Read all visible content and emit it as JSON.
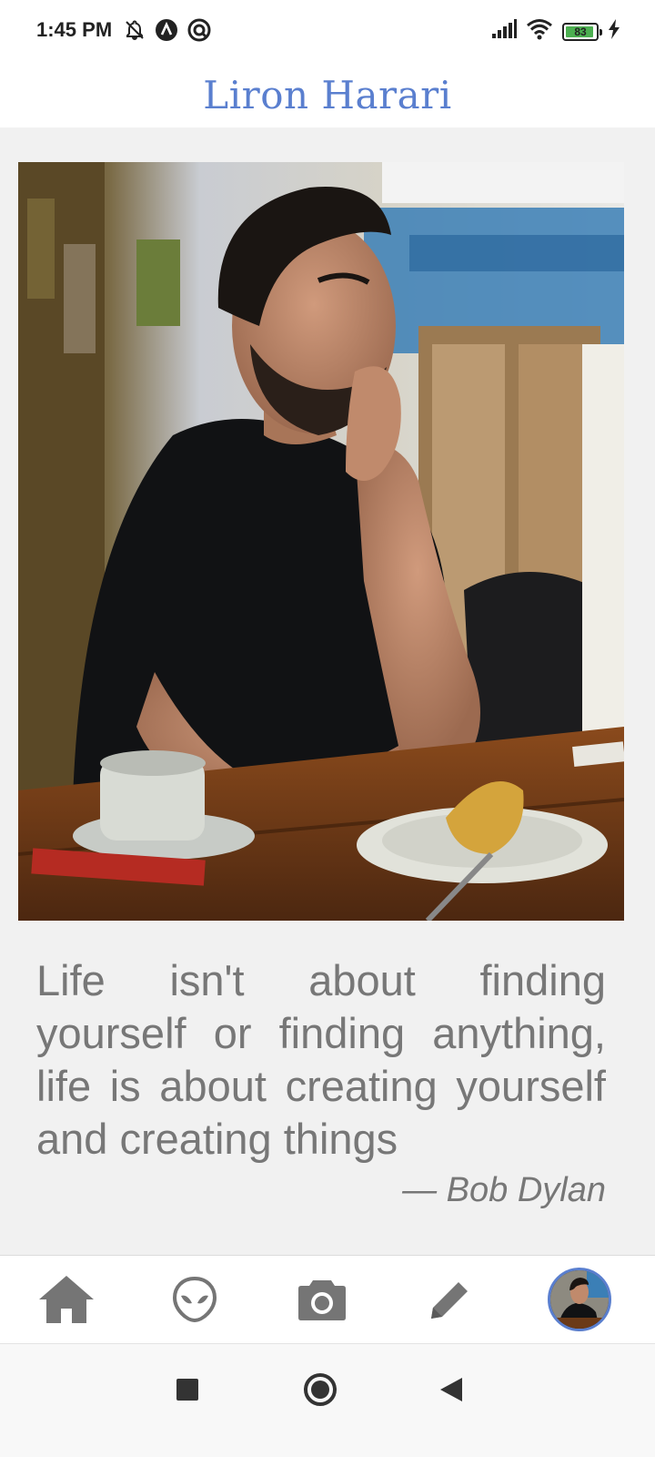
{
  "status_bar": {
    "time": "1:45 PM",
    "battery_level": "83",
    "left_icons": [
      "notifications-off-icon",
      "app-a-icon",
      "app-circle-icon"
    ],
    "right_icons": [
      "signal-icon",
      "wifi-icon",
      "battery-icon",
      "charging-icon"
    ]
  },
  "header": {
    "title": "Liron Harari"
  },
  "main": {
    "photo_description_icon": "profile-photo",
    "quote": "Life isn't about finding yourself or finding anything, life is about creating yourself and creating things",
    "author": "— Bob Dylan"
  },
  "bottom_nav": {
    "items": [
      "home-icon",
      "alien-icon",
      "camera-icon",
      "pencil-icon",
      "avatar"
    ]
  },
  "system_nav": {
    "items": [
      "recents-square-icon",
      "home-circle-icon",
      "back-triangle-icon"
    ]
  },
  "colors": {
    "accent": "#5a7fcf",
    "text_muted": "#777777",
    "background": "#f1f1f1",
    "icon_gray": "#757575"
  }
}
